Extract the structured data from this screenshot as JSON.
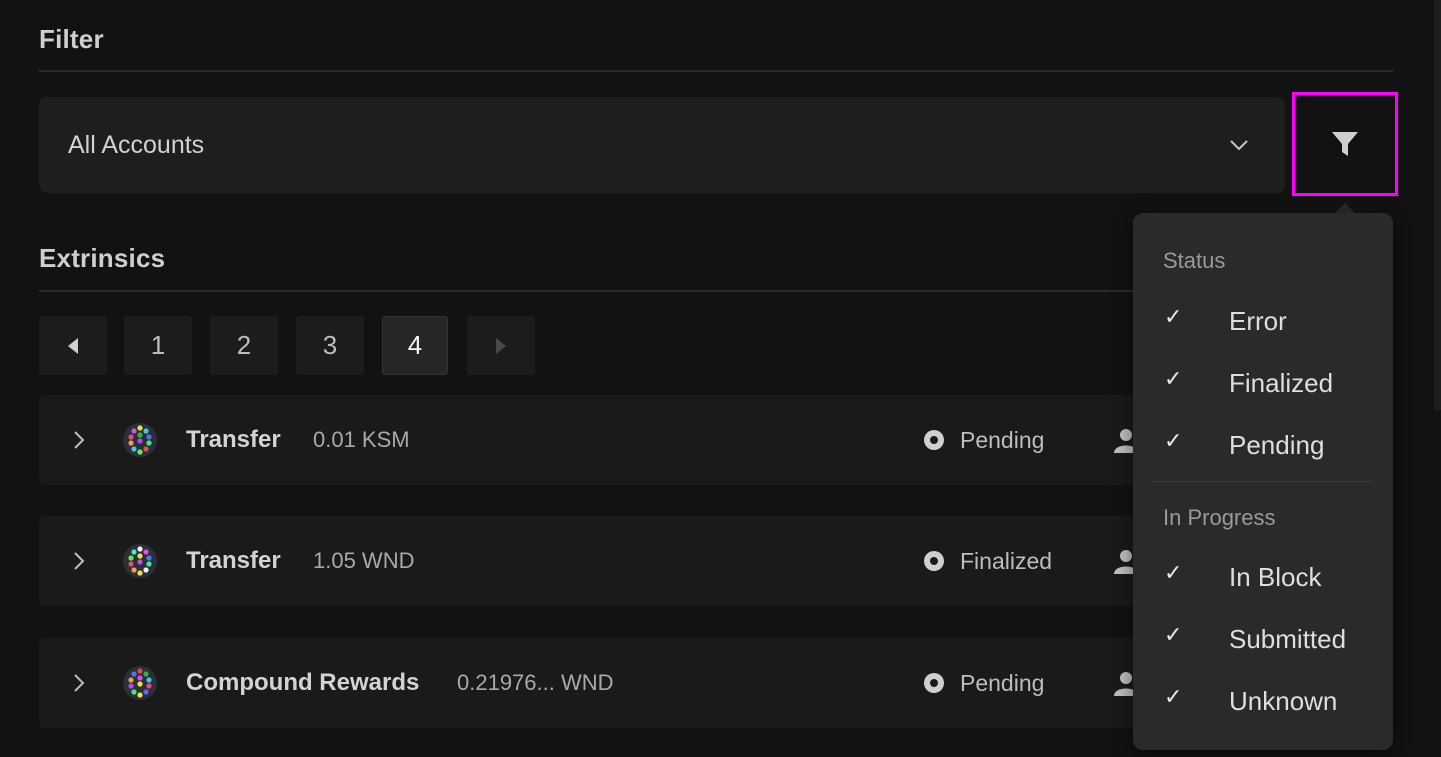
{
  "filter_section": {
    "title": "Filter"
  },
  "account_select": {
    "value": "All Accounts"
  },
  "extrinsics_section": {
    "title": "Extrinsics"
  },
  "pagination": {
    "pages": [
      "1",
      "2",
      "3",
      "4"
    ],
    "active_page": "4"
  },
  "rows": [
    {
      "title": "Transfer",
      "amount": "0.01 KSM",
      "status": "Pending"
    },
    {
      "title": "Transfer",
      "amount": "1.05 WND",
      "status": "Finalized"
    },
    {
      "title": "Compound Rewards",
      "amount": "0.21976... WND",
      "status": "Pending"
    }
  ],
  "filter_dropdown": {
    "status_header": "Status",
    "status_items": [
      {
        "label": "Error",
        "check": "✓"
      },
      {
        "label": "Finalized",
        "check": "✓"
      },
      {
        "label": "Pending",
        "check": "✓"
      }
    ],
    "progress_header": "In Progress",
    "progress_items": [
      {
        "label": "In Block",
        "check": "✓"
      },
      {
        "label": "Submitted",
        "check": "✓"
      },
      {
        "label": "Unknown",
        "check": "✓"
      }
    ]
  },
  "colors": {
    "background": "#121212",
    "panel": "#1e1e1e",
    "dropdown": "#2a2a2a",
    "highlight_border": "#ff00ff"
  },
  "icons": {
    "chevron_down": "chevron-down-icon",
    "filter": "funnel-icon",
    "expand": "chevron-right-icon",
    "status": "status-dot-icon",
    "user": "user-icon",
    "identicon": "identicon-icon",
    "prev": "caret-left-icon",
    "next": "caret-right-icon"
  }
}
